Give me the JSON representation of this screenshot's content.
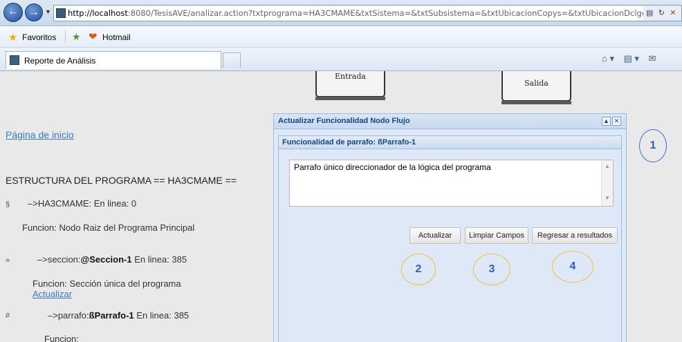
{
  "browser": {
    "url_host": "http://localhost",
    "url_rest": ":8080/TesisAVE/analizar.action?txtprograma=HA3CMAME&txtSistema=&txtSubsistema=&txtUbicacionCopys=&txtUbicacionDclge",
    "favorites_label": "Favoritos",
    "hotmail_label": "Hotmail",
    "tab_title": "Reporte de Análisis"
  },
  "flow": {
    "entrada_label": "Entrada",
    "salida_label": "Salida"
  },
  "page": {
    "home_link": "Página de inicio",
    "structure_title": "ESTRUCTURA DEL PROGRAMA == HA3CMAME ==",
    "tree": [
      {
        "bullet": "§",
        "prefix": "–>HA3CMAME: En linea: 0",
        "bold": "",
        "suffix": ""
      },
      {
        "bullet": "",
        "prefix": "Funcion: Nodo Raiz del Programa Principal",
        "bold": "",
        "suffix": ""
      },
      {
        "bullet": "»",
        "prefix": "–>seccion:",
        "bold": "@Seccion-1",
        "suffix": " En linea: 385"
      },
      {
        "bullet": "",
        "prefix": "Funcion: Sección única del programa",
        "bold": "",
        "suffix": ""
      },
      {
        "bullet": "",
        "prefix": "Actualizar",
        "bold": "",
        "suffix": ""
      },
      {
        "bullet": "#",
        "prefix": "–>parrafo:",
        "bold": "ßParrafo-1",
        "suffix": " En linea: 385"
      },
      {
        "bullet": "",
        "prefix": "Funcion:",
        "bold": "",
        "suffix": ""
      }
    ]
  },
  "dialog": {
    "title": "Actualizar Funcionalidad Nodo Flujo",
    "panel_title": "Funcionalidad de parrafo: ßParrafo-1",
    "textarea_value": "Parrafo único direccionador de la lógica del programa",
    "buttons": {
      "update": "Actualizar",
      "clear": "Limpiar Campos",
      "back": "Regresar a resultados"
    }
  },
  "annotations": [
    "1",
    "2",
    "3",
    "4"
  ],
  "colors": {
    "dialog_title": "#15428b",
    "link": "#3b78c8",
    "annotation_blue": "#3a6fe0",
    "annotation_yellow": "#f0c030"
  }
}
